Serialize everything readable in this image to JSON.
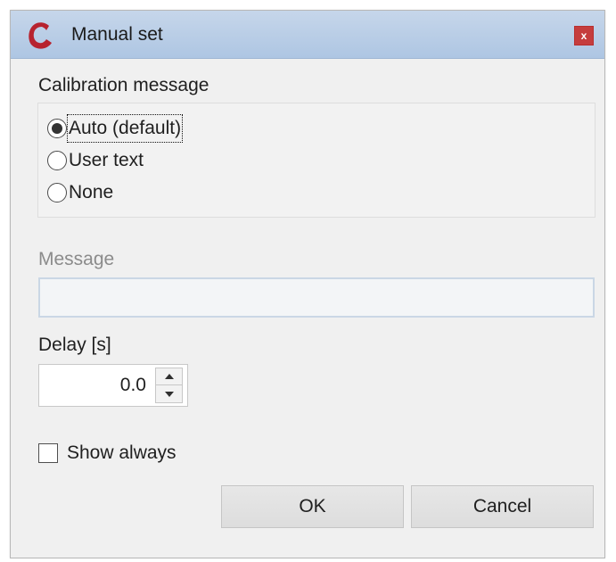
{
  "window": {
    "title": "Manual set",
    "logo_icon": "app-logo-icon",
    "close_label": "x",
    "colors": {
      "titlebar": "#bcd1ea",
      "close_button": "#c53d3d",
      "dialog_background": "#f0f0f0"
    }
  },
  "calibration_message": {
    "heading": "Calibration message",
    "options": [
      {
        "label": "Auto (default)",
        "selected": true
      },
      {
        "label": "User text",
        "selected": false
      },
      {
        "label": "None",
        "selected": false
      }
    ]
  },
  "message": {
    "label": "Message",
    "value": "",
    "disabled": true
  },
  "delay": {
    "label": "Delay [s]",
    "value": "0.0"
  },
  "show_always": {
    "label": "Show always",
    "checked": false
  },
  "buttons": {
    "ok_label": "OK",
    "cancel_label": "Cancel"
  }
}
